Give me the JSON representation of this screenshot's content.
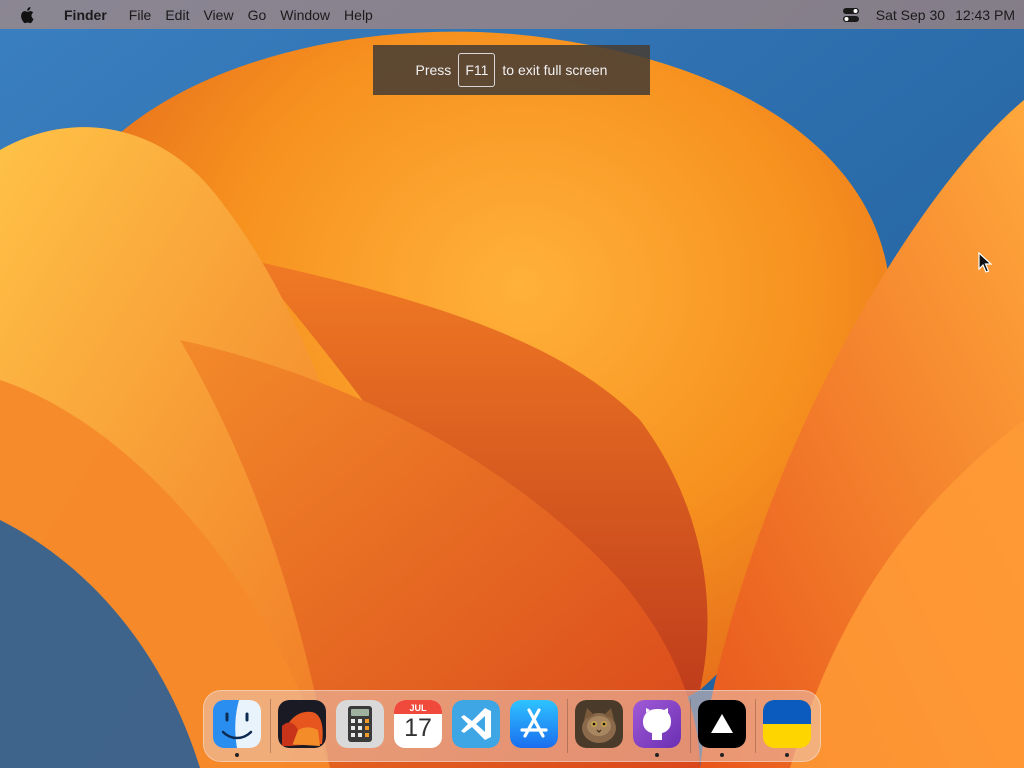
{
  "menubar": {
    "app_name": "Finder",
    "menus": [
      "File",
      "Edit",
      "View",
      "Go",
      "Window",
      "Help"
    ],
    "date": "Sat Sep 30",
    "time": "12:43 PM"
  },
  "toast": {
    "prefix": "Press",
    "key": "F11",
    "suffix": "to exit full screen"
  },
  "dock": {
    "calendar": {
      "month": "JUL",
      "day": "17"
    },
    "apps": [
      {
        "icon": "finder-icon",
        "running": true
      },
      {
        "icon": "wallpaper-app-icon",
        "running": false
      },
      {
        "icon": "calculator-icon",
        "running": false
      },
      {
        "icon": "calendar-icon",
        "running": false
      },
      {
        "icon": "vscode-icon",
        "running": false
      },
      {
        "icon": "app-store-icon",
        "running": false
      },
      {
        "icon": "cat-photo-icon",
        "running": false
      },
      {
        "icon": "github-icon",
        "running": true
      },
      {
        "icon": "vercel-icon",
        "running": true
      },
      {
        "icon": "ukraine-flag-icon",
        "running": true
      }
    ]
  },
  "colors": {
    "wallpaper_blue": "#2f6fb0",
    "wallpaper_orange": "#f58a1f",
    "wallpaper_deep": "#c2381a"
  }
}
